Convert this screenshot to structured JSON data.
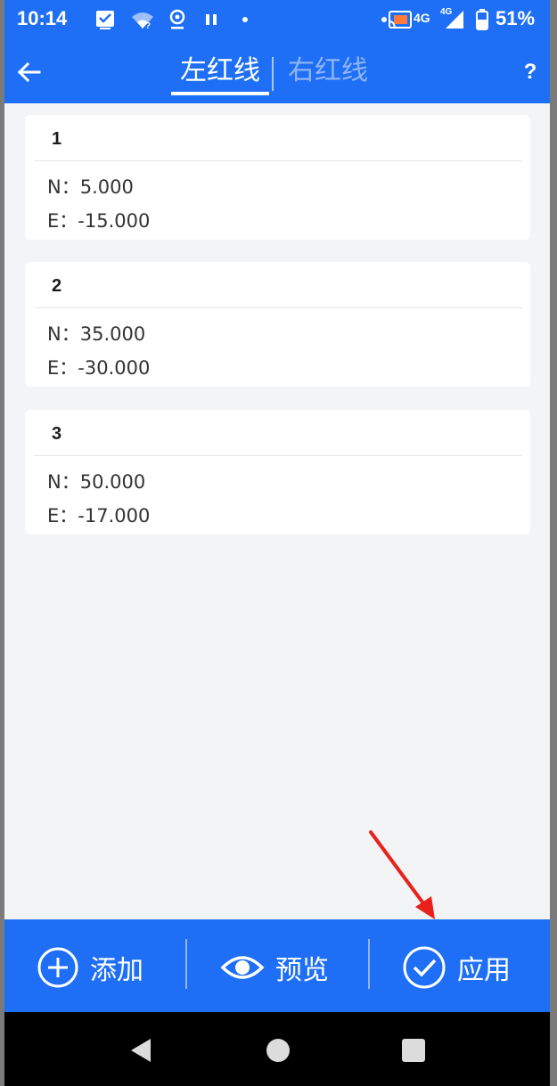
{
  "status_bar": {
    "time": "10:14",
    "network": "4G",
    "network2": "4G",
    "battery": "51%",
    "icons": [
      "check-box-icon",
      "wifi-icon",
      "location-icon",
      "pause-icon",
      "dot-icon",
      "cast-icon",
      "signal-icon",
      "battery-icon"
    ]
  },
  "app_bar": {
    "tabs": [
      {
        "label": "左红线",
        "selected": true
      },
      {
        "label": "右红线",
        "selected": false
      }
    ],
    "help_label": "?"
  },
  "points": [
    {
      "index": "1",
      "n_label": "N：",
      "n_value": "5.000",
      "e_label": "E：",
      "e_value": "-15.000"
    },
    {
      "index": "2",
      "n_label": "N：",
      "n_value": "35.000",
      "e_label": "E：",
      "e_value": "-30.000"
    },
    {
      "index": "3",
      "n_label": "N：",
      "n_value": "50.000",
      "e_label": "E：",
      "e_value": "-17.000"
    }
  ],
  "actions": {
    "add_label": "添加",
    "preview_label": "预览",
    "apply_label": "应用"
  },
  "colors": {
    "primary": "#1e6ff5",
    "background": "#f2f4f6",
    "annotation": "#e8221b"
  }
}
